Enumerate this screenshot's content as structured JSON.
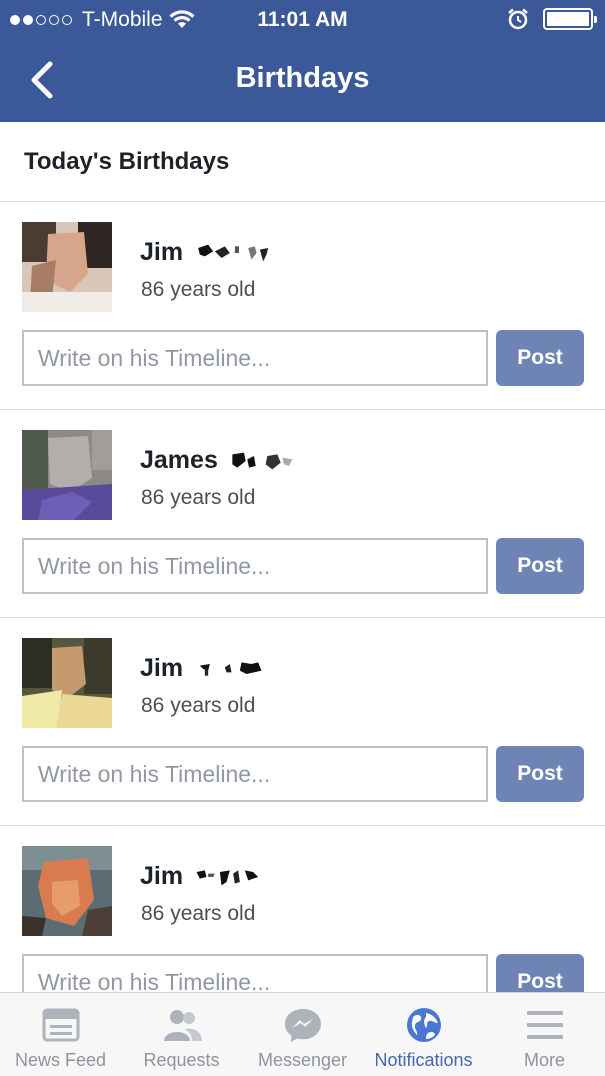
{
  "status_bar": {
    "carrier": "T-Mobile",
    "time": "11:01 AM"
  },
  "nav": {
    "title": "Birthdays"
  },
  "section": {
    "heading": "Today's Birthdays"
  },
  "birthdays": [
    {
      "name": "Jim",
      "age": "86 years old",
      "placeholder": "Write on his Timeline...",
      "post_label": "Post"
    },
    {
      "name": "James",
      "age": "86 years old",
      "placeholder": "Write on his Timeline...",
      "post_label": "Post"
    },
    {
      "name": "Jim",
      "age": "86 years old",
      "placeholder": "Write on his Timeline...",
      "post_label": "Post"
    },
    {
      "name": "Jim",
      "age": "86 years old",
      "placeholder": "Write on his Timeline...",
      "post_label": "Post"
    }
  ],
  "tabs": [
    {
      "label": "News Feed",
      "icon": "news-feed-icon"
    },
    {
      "label": "Requests",
      "icon": "friend-requests-icon"
    },
    {
      "label": "Messenger",
      "icon": "messenger-icon"
    },
    {
      "label": "Notifications",
      "icon": "globe-icon",
      "active": true
    },
    {
      "label": "More",
      "icon": "menu-icon"
    }
  ],
  "colors": {
    "brand": "#3b5998",
    "post_button": "#6d84b4",
    "active_tab": "#4267b2",
    "inactive_tab": "#8d949e"
  }
}
